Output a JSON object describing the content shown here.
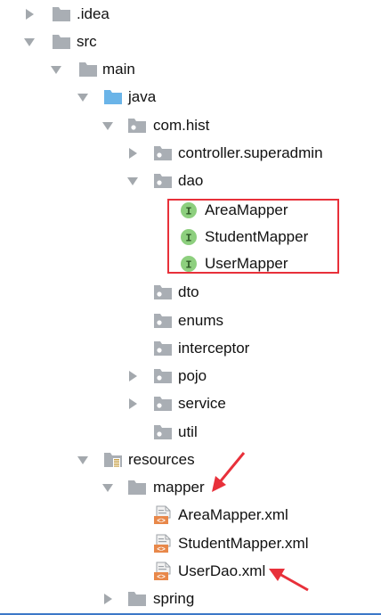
{
  "tree": {
    "idea": ".idea",
    "src": "src",
    "main": "main",
    "java": "java",
    "com_hist": "com.hist",
    "controller": "controller.superadmin",
    "dao": "dao",
    "area_mapper": "AreaMapper",
    "student_mapper": "StudentMapper",
    "user_mapper": "UserMapper",
    "dto": "dto",
    "enums": "enums",
    "interceptor": "interceptor",
    "pojo": "pojo",
    "service": "service",
    "util": "util",
    "resources": "resources",
    "mapper": "mapper",
    "area_mapper_xml": "AreaMapper.xml",
    "student_mapper_xml": "StudentMapper.xml",
    "user_dao_xml": "UserDao.xml",
    "spring": "spring",
    "interface_badge": "I",
    "xml_badge": "<>"
  },
  "colors": {
    "folder_gray": "#a9aeb4",
    "folder_blue": "#6ab4e8",
    "interface_green": "#8dcf7e",
    "xml_orange": "#e8884a",
    "highlight_red": "#e8303a",
    "arrow_gray": "#a3a8ad"
  },
  "icons": {
    "folder": "folder-icon",
    "source_folder": "source-root-folder-icon",
    "package": "package-icon",
    "resources_folder": "resources-folder-icon",
    "interface": "interface-icon",
    "xml_file": "xml-file-icon"
  }
}
